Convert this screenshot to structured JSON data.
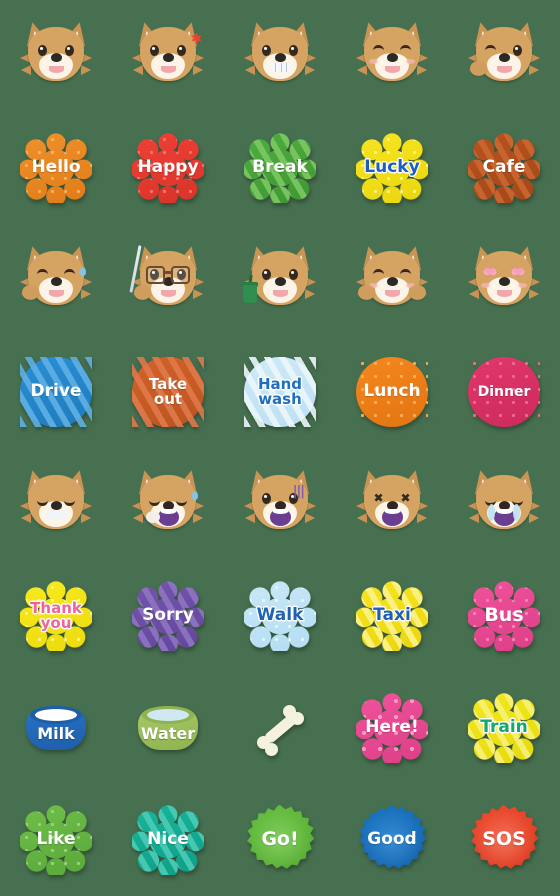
{
  "sheet": {
    "background_color": "#477050",
    "columns": 5,
    "rows": 8,
    "items": [
      {
        "id": "dog-neutral-smile",
        "kind": "dog",
        "label": "neutral smiling shiba",
        "face": "smile"
      },
      {
        "id": "dog-wink-angry",
        "kind": "dog",
        "label": "shiba with anger mark",
        "face": "anger"
      },
      {
        "id": "dog-grin-teeth",
        "kind": "dog",
        "label": "shiba grinning with teeth",
        "face": "teeth"
      },
      {
        "id": "dog-happy-closed-eyes",
        "kind": "dog",
        "label": "happy shiba closed eyes",
        "face": "happy"
      },
      {
        "id": "dog-wink-paw",
        "kind": "dog",
        "label": "winking shiba with paw",
        "face": "wink"
      },
      {
        "id": "badge-hello",
        "kind": "badge",
        "text": "Hello",
        "shape": "scallop",
        "bg": "#f0912c",
        "bg2": "#e07c18",
        "text_color": "#ffffff",
        "pattern": "dots",
        "pattern_color": "#f7b55e"
      },
      {
        "id": "badge-happy",
        "kind": "badge",
        "text": "Happy",
        "shape": "scallop",
        "bg": "#ef4136",
        "bg2": "#d8332a",
        "text_color": "#ffffff",
        "pattern": "dots",
        "pattern_color": "#f5776d"
      },
      {
        "id": "badge-break",
        "kind": "badge",
        "text": "Break",
        "shape": "scallop",
        "bg": "#4fae3e",
        "bg2": "#3f9632",
        "text_color": "#ffffff",
        "pattern": "stripes",
        "pattern_color": "#7cc863"
      },
      {
        "id": "badge-lucky",
        "kind": "badge",
        "text": "Lucky",
        "shape": "scallop",
        "bg": "#f7e51f",
        "bg2": "#ead60f",
        "text_color": "#1a5fbf",
        "pattern": "dots",
        "pattern_color": "#fdf48d"
      },
      {
        "id": "badge-cafe",
        "kind": "badge",
        "text": "Cafe",
        "shape": "scallop",
        "bg": "#b9531f",
        "bg2": "#a34718",
        "text_color": "#ffffff",
        "pattern": "stripes",
        "pattern_color": "#cb6630"
      },
      {
        "id": "dog-sweat-wink",
        "kind": "dog",
        "label": "shiba sweating",
        "face": "sweat"
      },
      {
        "id": "dog-glasses-pen",
        "kind": "dog",
        "label": "shiba with glasses and pen",
        "face": "glasses"
      },
      {
        "id": "dog-coffee",
        "kind": "dog",
        "label": "shiba holding coffee cup",
        "face": "coffee"
      },
      {
        "id": "dog-laughing",
        "kind": "dog",
        "label": "laughing shiba with paws",
        "face": "laugh"
      },
      {
        "id": "dog-heart-eyes",
        "kind": "dog",
        "label": "shiba with heart eyes",
        "face": "hearts"
      },
      {
        "id": "badge-drive",
        "kind": "badge",
        "text": "Drive",
        "shape": "circle",
        "bg": "#2a8ed4",
        "bg2": "#1f7cbd",
        "text_color": "#ffffff",
        "pattern": "stripes",
        "pattern_color": "#5fb0e4"
      },
      {
        "id": "badge-take-out",
        "kind": "badge",
        "text": "Take\nout",
        "shape": "circle",
        "bg": "#d2622a",
        "bg2": "#bb5420",
        "text_color": "#ffffff",
        "pattern": "stripes",
        "pattern_color": "#e0794a"
      },
      {
        "id": "badge-hand-wash",
        "kind": "badge",
        "text": "Hand\nwash",
        "shape": "circle",
        "bg": "#cfeaf7",
        "bg2": "#bbdff2",
        "text_color": "#1f6fc0",
        "pattern": "stripes",
        "pattern_color": "#ebf7fc"
      },
      {
        "id": "badge-lunch",
        "kind": "badge",
        "text": "Lunch",
        "shape": "circle",
        "bg": "#f5871f",
        "bg2": "#e27510",
        "text_color": "#ffffff",
        "pattern": "dots",
        "pattern_color": "#fbb05c"
      },
      {
        "id": "badge-dinner",
        "kind": "badge",
        "text": "Dinner",
        "shape": "circle",
        "bg": "#e2376b",
        "bg2": "#cc2a5c",
        "text_color": "#ffffff",
        "pattern": "dots",
        "pattern_color": "#ef6c94"
      },
      {
        "id": "dog-content-sleep",
        "kind": "dog",
        "label": "content shiba eyes closed",
        "face": "content"
      },
      {
        "id": "dog-sleepy-bubble",
        "kind": "dog",
        "label": "sleepy shiba with snot bubble",
        "face": "sleepy"
      },
      {
        "id": "dog-shock-vein",
        "kind": "dog",
        "label": "shocked shiba with anger vein",
        "face": "shock"
      },
      {
        "id": "dog-dead-x-eyes",
        "kind": "dog",
        "label": "shiba with x eyes screaming",
        "face": "dead"
      },
      {
        "id": "dog-crying",
        "kind": "dog",
        "label": "crying shiba",
        "face": "cry"
      },
      {
        "id": "badge-thank-you",
        "kind": "badge",
        "text": "Thank\nyou",
        "shape": "scallop",
        "bg": "#f9ea1e",
        "bg2": "#ecdb0c",
        "text_color": "#f0649c",
        "pattern": "dots",
        "pattern_color": "#fdf58e"
      },
      {
        "id": "badge-sorry",
        "kind": "badge",
        "text": "Sorry",
        "shape": "scallop",
        "bg": "#7355ac",
        "bg2": "#64479a",
        "text_color": "#ffffff",
        "pattern": "stripes",
        "pattern_color": "#8e74c1"
      },
      {
        "id": "badge-walk",
        "kind": "badge",
        "text": "Walk",
        "shape": "scallop",
        "bg": "#c9e8f7",
        "bg2": "#b3ddf2",
        "text_color": "#1f63b5",
        "pattern": "dots",
        "pattern_color": "#e7f6fc"
      },
      {
        "id": "badge-taxi",
        "kind": "badge",
        "text": "Taxi",
        "shape": "scallop",
        "bg": "#f7e51f",
        "bg2": "#ead60f",
        "text_color": "#1f5fb8",
        "pattern": "stripes",
        "pattern_color": "#fdf28a"
      },
      {
        "id": "badge-bus",
        "kind": "badge",
        "text": "Bus",
        "shape": "scallop",
        "bg": "#f0529c",
        "bg2": "#dc3e88",
        "text_color": "#ffffff",
        "pattern": "dots",
        "pattern_color": "#f785b9"
      },
      {
        "id": "bowl-milk",
        "kind": "bowl",
        "text": "Milk",
        "bowl_color": "#2a72c4",
        "bowl_color2": "#1d5ea9",
        "liquid_color": "#ffffff",
        "text_color": "#ffffff"
      },
      {
        "id": "bowl-water",
        "kind": "bowl",
        "text": "Water",
        "bowl_color": "#a8c96a",
        "bowl_color2": "#8fb34f",
        "liquid_color": "#cfe8f2",
        "text_color": "#ffffff"
      },
      {
        "id": "bone",
        "kind": "bone",
        "label": "dog bone",
        "color": "#f4f2df"
      },
      {
        "id": "badge-here",
        "kind": "badge",
        "text": "Here!",
        "shape": "scallop",
        "bg": "#f0529c",
        "bg2": "#dc3e88",
        "text_color": "#ffffff",
        "pattern": "stars",
        "pattern_color": "#f7a0c8"
      },
      {
        "id": "badge-train",
        "kind": "badge",
        "text": "Train",
        "shape": "scallop",
        "bg": "#f2e81d",
        "bg2": "#e4da0c",
        "text_color": "#16a868",
        "pattern": "stripes",
        "pattern_color": "#f8f078"
      },
      {
        "id": "badge-like",
        "kind": "badge",
        "text": "Like",
        "shape": "scallop",
        "bg": "#6fbf4a",
        "bg2": "#5aa839",
        "text_color": "#ffffff",
        "pattern": "dots",
        "pattern_color": "#9ed47f"
      },
      {
        "id": "badge-nice",
        "kind": "badge",
        "text": "Nice",
        "shape": "scallop",
        "bg": "#18b59a",
        "bg2": "#0f9e86",
        "text_color": "#ffffff",
        "pattern": "stripes",
        "pattern_color": "#4ccbb6"
      },
      {
        "id": "badge-go",
        "kind": "badge",
        "text": "Go!",
        "shape": "burst",
        "bg": "#66c03f",
        "bg2": "#53a830",
        "text_color": "#ffffff",
        "pattern": "radial",
        "pattern_color": "#8bd268"
      },
      {
        "id": "badge-good",
        "kind": "badge",
        "text": "Good",
        "shape": "burst",
        "bg": "#1a75c4",
        "bg2": "#1462aa",
        "text_color": "#ffffff",
        "pattern": "radial",
        "pattern_color": "#3e93d9"
      },
      {
        "id": "badge-sos",
        "kind": "badge",
        "text": "SOS",
        "shape": "burst",
        "bg": "#ef4a2e",
        "bg2": "#d93a20",
        "text_color": "#ffffff",
        "pattern": "radial",
        "pattern_color": "#f57a62"
      }
    ]
  }
}
